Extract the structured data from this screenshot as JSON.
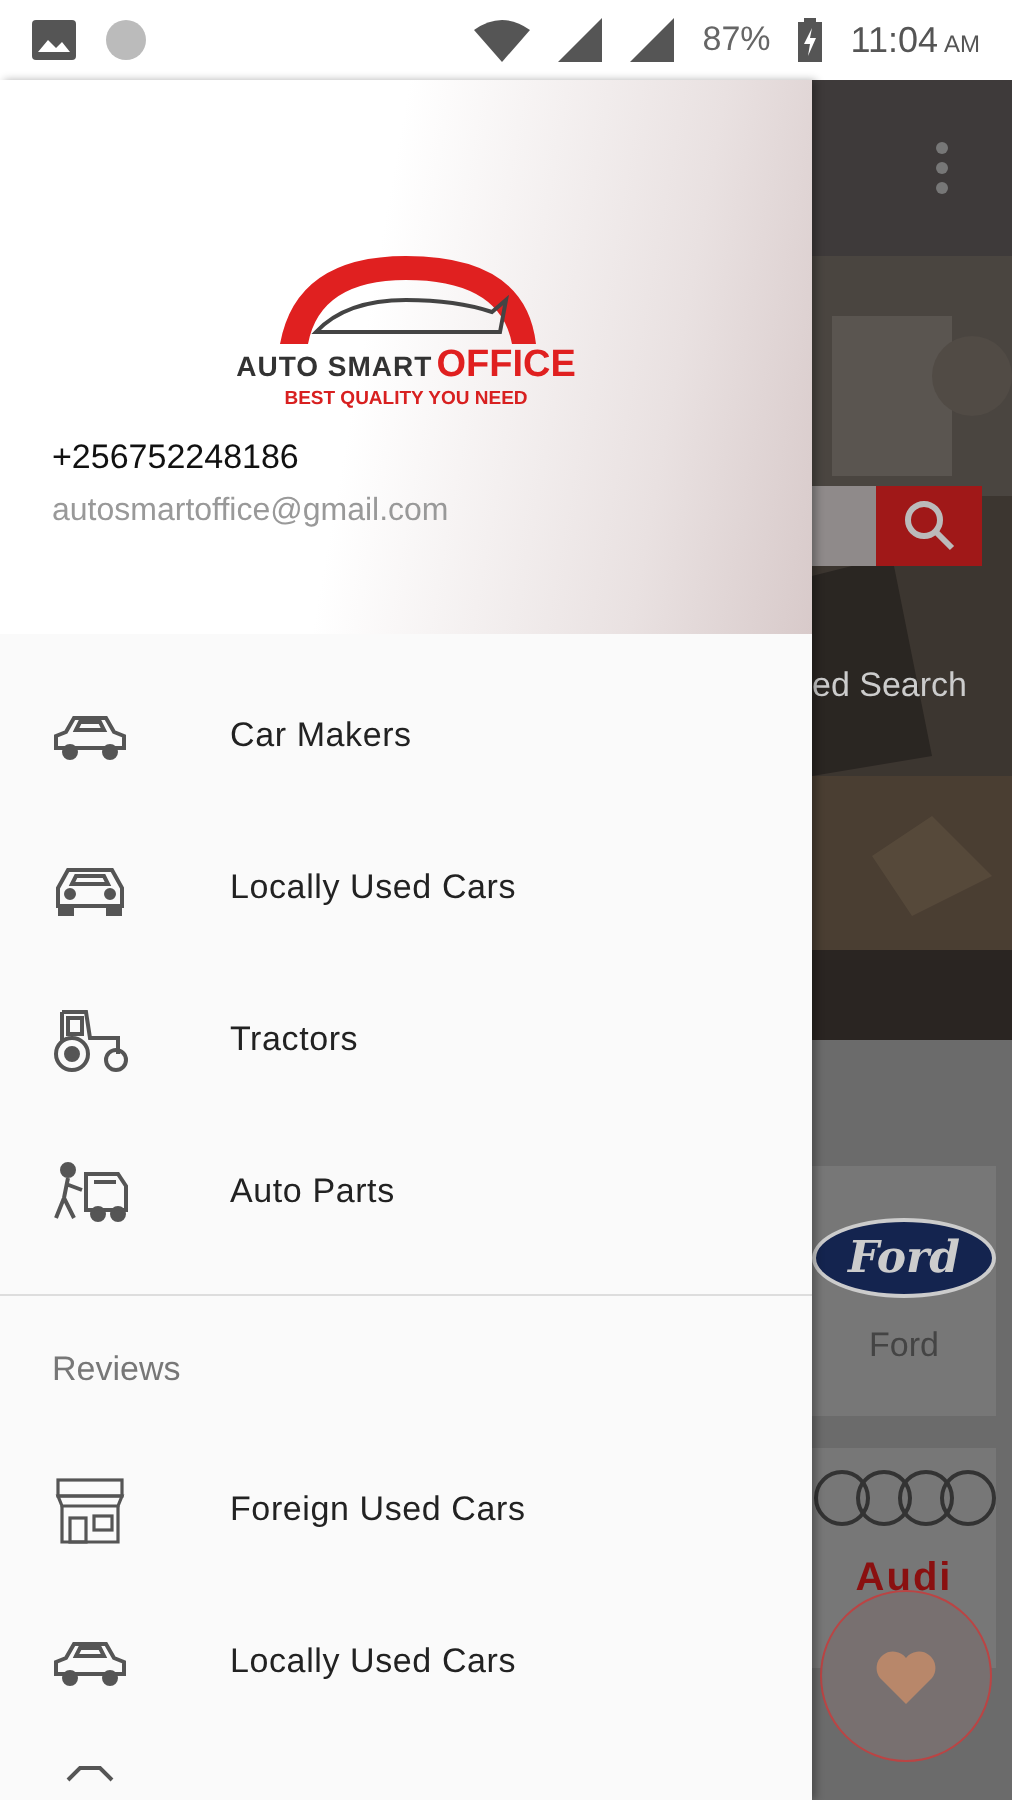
{
  "status_bar": {
    "battery": "87%",
    "time": "11:04",
    "time_suffix": "AM"
  },
  "drawer": {
    "header": {
      "logo": {
        "word_1": "AUTO SMART",
        "word_2": "OFFICE",
        "tagline": "BEST QUALITY YOU NEED"
      },
      "phone": "+256752248186",
      "email": "autosmartoffice@gmail.com"
    },
    "items": [
      {
        "label": "Car Makers",
        "kind": "car"
      },
      {
        "label": "Locally Used Cars",
        "kind": "car-front"
      },
      {
        "label": "Tractors",
        "kind": "tractor"
      },
      {
        "label": "Auto Parts",
        "kind": "mechanic"
      }
    ],
    "sections": [
      {
        "title": "Reviews",
        "items": [
          {
            "label": "Foreign Used Cars",
            "kind": "shop"
          },
          {
            "label": "Locally Used Cars",
            "kind": "car"
          },
          {
            "kind": "partial"
          }
        ]
      }
    ]
  },
  "background": {
    "search_label": "ed Search",
    "brands": [
      {
        "logo": "Ford",
        "name": "Ford"
      },
      {
        "logo": "Audi"
      }
    ]
  }
}
